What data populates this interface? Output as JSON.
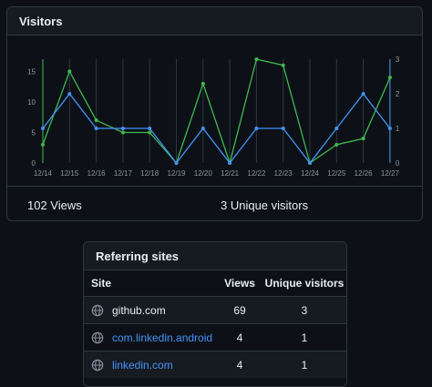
{
  "visitors_card": {
    "title": "Visitors",
    "views_summary": "102 Views",
    "unique_summary": "3 Unique visitors"
  },
  "colors": {
    "views": "#3fb950",
    "unique": "#4493f8",
    "grid": "#30363d",
    "tick": "#8b949e"
  },
  "chart_data": {
    "type": "line",
    "categories": [
      "12/14",
      "12/15",
      "12/16",
      "12/17",
      "12/18",
      "12/19",
      "12/20",
      "12/21",
      "12/22",
      "12/23",
      "12/24",
      "12/25",
      "12/26",
      "12/27"
    ],
    "series": [
      {
        "values": [
          3,
          15,
          7,
          5,
          5,
          0,
          13,
          0,
          17,
          16,
          0,
          3,
          4,
          14
        ],
        "axis": "left",
        "color": "#3fb950"
      },
      {
        "values": [
          1,
          2,
          1,
          1,
          1,
          0,
          1,
          0,
          1,
          1,
          0,
          1,
          2,
          1
        ],
        "axis": "right",
        "color": "#4493f8"
      }
    ],
    "y_left": {
      "ticks": [
        0,
        5,
        10,
        15
      ],
      "range": [
        0,
        17
      ]
    },
    "y_right": {
      "ticks": [
        0,
        1,
        2,
        3
      ],
      "range": [
        0,
        3
      ]
    },
    "grid": "vertical"
  },
  "referring_sites": {
    "title": "Referring sites",
    "headers": {
      "site": "Site",
      "views": "Views",
      "unique": "Unique visitors"
    },
    "rows": [
      {
        "site": "github.com",
        "views": "69",
        "unique": "3"
      },
      {
        "site": "com.linkedin.android",
        "views": "4",
        "unique": "1"
      },
      {
        "site": "linkedin.com",
        "views": "4",
        "unique": "1"
      }
    ]
  }
}
